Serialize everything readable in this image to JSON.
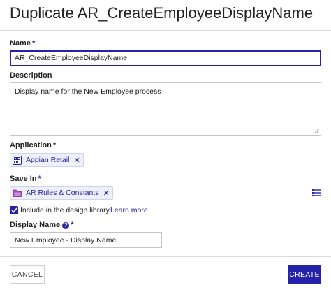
{
  "dialog": {
    "title": "Duplicate AR_CreateEmployeeDisplayName"
  },
  "form": {
    "name": {
      "label": "Name",
      "required_mark": "*",
      "value": "AR_CreateEmployeeDisplayName"
    },
    "description": {
      "label": "Description",
      "value": "Display name for the New Employee process"
    },
    "application": {
      "label": "Application",
      "required_mark": "*",
      "chip_label": "Appian Retail",
      "chip_icon": "application-icon"
    },
    "save_in": {
      "label": "Save In",
      "required_mark": "*",
      "chip_label": "AR Rules & Constants",
      "chip_icon": "folder-icon",
      "list_icon": "list-icon"
    },
    "design_library": {
      "label": "Include in the design library.",
      "checked": true,
      "link": "Learn more"
    },
    "display_name": {
      "label": "Display Name",
      "help_icon": "help-icon",
      "required_mark": "*",
      "value": "New Employee - Display Name"
    }
  },
  "footer": {
    "cancel_label": "CANCEL",
    "create_label": "CREATE"
  },
  "colors": {
    "accent": "#2322a8",
    "chip_bg": "#eef0fb",
    "divider": "#d9d9d9"
  }
}
